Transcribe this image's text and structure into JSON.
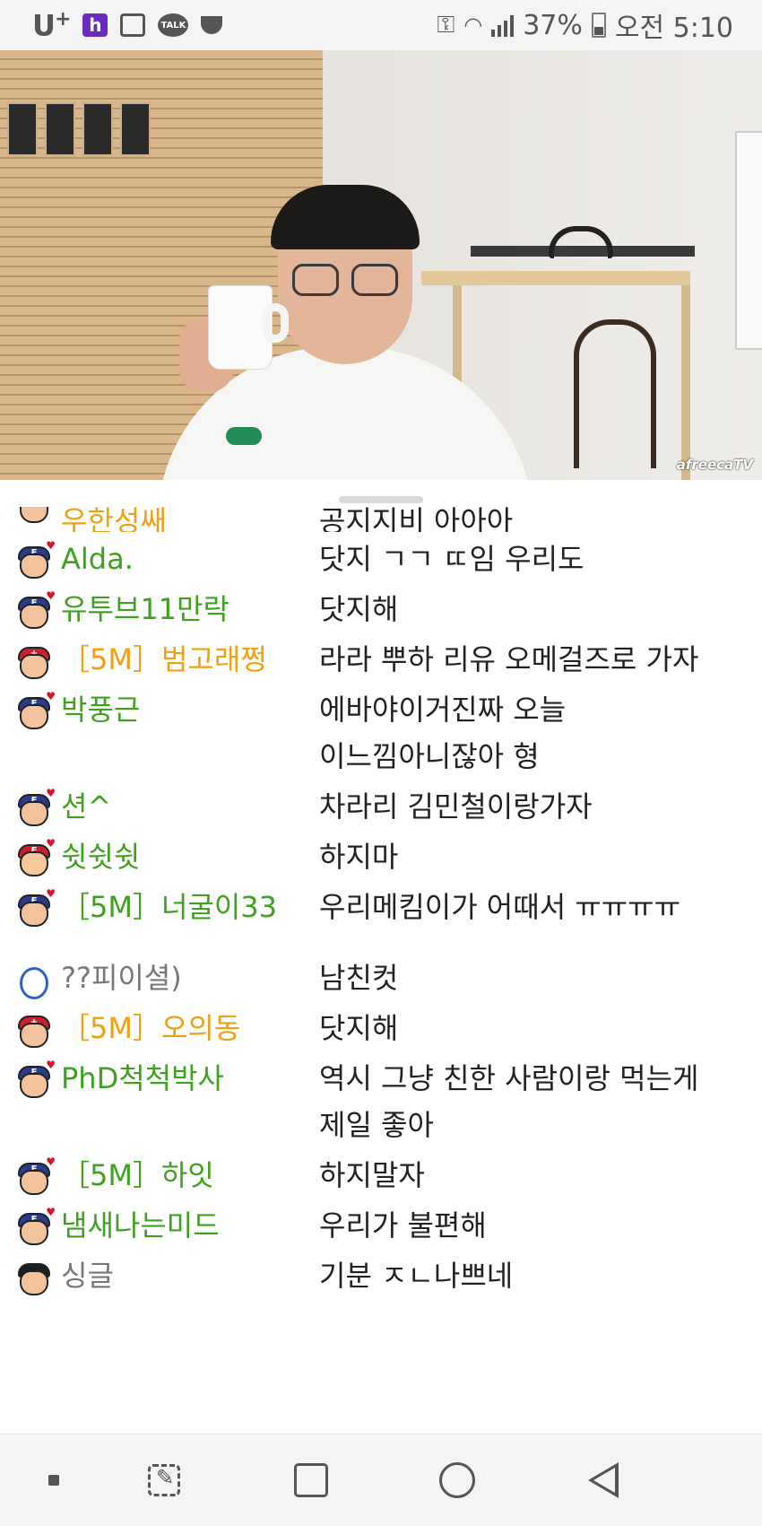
{
  "status_bar": {
    "carrier": "U",
    "carrier_sup": "+",
    "battery_percent": "37%",
    "time": "오전 5:10",
    "talk_icon_label": "TALK",
    "h_icon_label": "h"
  },
  "video": {
    "watermark": "afreecaTV"
  },
  "chat": {
    "partial_top": {
      "nick": "우한성쌔",
      "msg": "공지지비 아아아"
    },
    "messages": [
      {
        "nick": "Alda.",
        "msg": "닷지 ㄱㄱ ㄸ임 우리도"
      },
      {
        "nick": "유투브11만락",
        "msg": "닷지해"
      },
      {
        "nick": "［5M］범고래쩡",
        "msg": "라라 뿌하 리유 오메걸즈로 가자"
      },
      {
        "nick": "박풍근",
        "msg": "에바야이거진짜 오늘 이느낌아니잖아 형"
      },
      {
        "nick": "션^",
        "msg": "차라리 김민철이랑가자"
      },
      {
        "nick": "쉿쉿쉿",
        "msg": "하지마"
      },
      {
        "nick": "［5M］너굴이33",
        "msg": "우리메킴이가 어때서 ㅠㅠㅠㅠ"
      },
      {
        "nick": "??피이셜)",
        "msg": "남친컷"
      },
      {
        "nick": "［5M］오의동",
        "msg": "닷지해"
      },
      {
        "nick": "PhD척척박사",
        "msg": "역시 그냥 친한 사람이랑 먹는게 제일 좋아"
      },
      {
        "nick": "［5M］하잇",
        "msg": "하지말자"
      },
      {
        "nick": "냄새나는미드",
        "msg": "우리가 불편해"
      },
      {
        "nick": "싱글",
        "msg": "기분 ㅈㄴ나쁘네"
      }
    ]
  },
  "colors": {
    "nick_green": "#3fa21f",
    "nick_orange": "#f0a010",
    "nick_gray": "#777777",
    "msg_text": "#222222"
  }
}
